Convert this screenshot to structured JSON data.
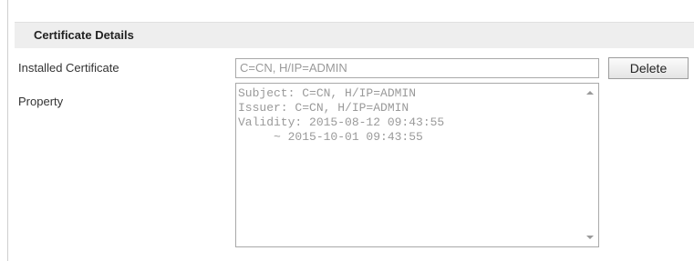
{
  "section": {
    "title": "Certificate Details"
  },
  "installed_certificate": {
    "label": "Installed Certificate",
    "value": "C=CN, H/IP=ADMIN"
  },
  "delete_button": {
    "label": "Delete"
  },
  "property": {
    "label": "Property",
    "lines": [
      "Subject: C=CN, H/IP=ADMIN",
      "Issuer: C=CN, H/IP=ADMIN",
      "Validity: 2015-08-12 09:43:55",
      "     ~ 2015-10-01 09:43:55"
    ]
  }
}
